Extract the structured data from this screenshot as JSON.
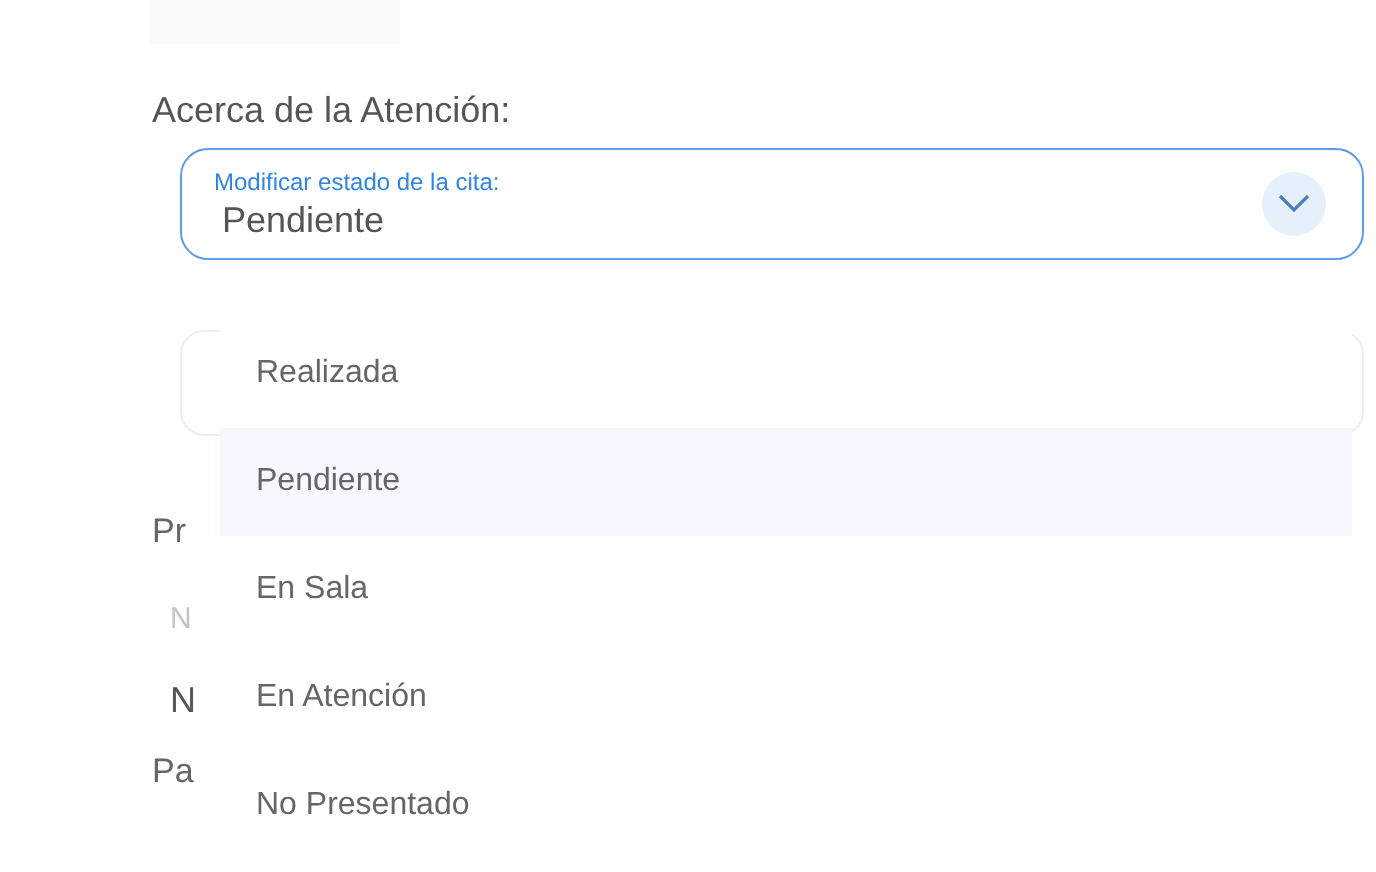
{
  "section_title": "Acerca de la Atención:",
  "status_select": {
    "label": "Modificar estado de la cita:",
    "value": "Pendiente",
    "expanded": true
  },
  "background_labels": [
    {
      "text": "Pr",
      "kind": "label"
    },
    {
      "text": "N",
      "kind": "placeholder"
    },
    {
      "text": "N",
      "kind": "value"
    },
    {
      "text": "Pa",
      "kind": "label"
    }
  ],
  "status_options": [
    {
      "label": "Realizada",
      "selected": false
    },
    {
      "label": "Pendiente",
      "selected": true
    },
    {
      "label": "En Sala",
      "selected": false
    },
    {
      "label": "En Atención",
      "selected": false
    },
    {
      "label": "No Presentado",
      "selected": false
    }
  ]
}
